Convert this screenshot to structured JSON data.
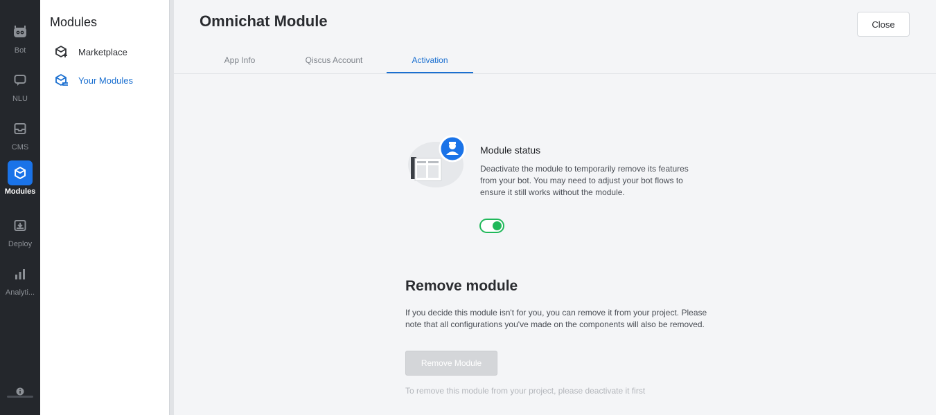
{
  "rail": {
    "items": [
      {
        "label": "Bot",
        "icon": "bot-icon"
      },
      {
        "label": "NLU",
        "icon": "chat-icon"
      },
      {
        "label": "CMS",
        "icon": "inbox-icon"
      },
      {
        "label": "Modules",
        "icon": "module-icon",
        "active": true
      },
      {
        "label": "Deploy",
        "icon": "deploy-icon"
      },
      {
        "label": "Analyti...",
        "icon": "analytics-icon"
      }
    ]
  },
  "subnav": {
    "title": "Modules",
    "items": [
      {
        "label": "Marketplace",
        "icon": "marketplace-icon"
      },
      {
        "label": "Your Modules",
        "icon": "your-modules-icon",
        "active": true
      }
    ]
  },
  "main": {
    "title": "Omnichat Module",
    "close_label": "Close",
    "tabs": [
      {
        "label": "App Info"
      },
      {
        "label": "Qiscus Account"
      },
      {
        "label": "Activation",
        "active": true
      }
    ],
    "status": {
      "title": "Module status",
      "description": "Deactivate the module to temporarily remove its features from your bot. You may need to adjust your bot flows to ensure it still works without the module.",
      "toggle_on": true
    },
    "remove": {
      "title": "Remove module",
      "description": "If you decide this module isn't for you, you can remove it from your project. Please note that all configurations you've made on the components will also be removed.",
      "button_label": "Remove Module",
      "hint": "To remove this module from your project, please deactivate it first"
    }
  },
  "colors": {
    "accent": "#1a73e8",
    "toggle_on": "#20b85a",
    "rail_bg": "#24272c"
  }
}
